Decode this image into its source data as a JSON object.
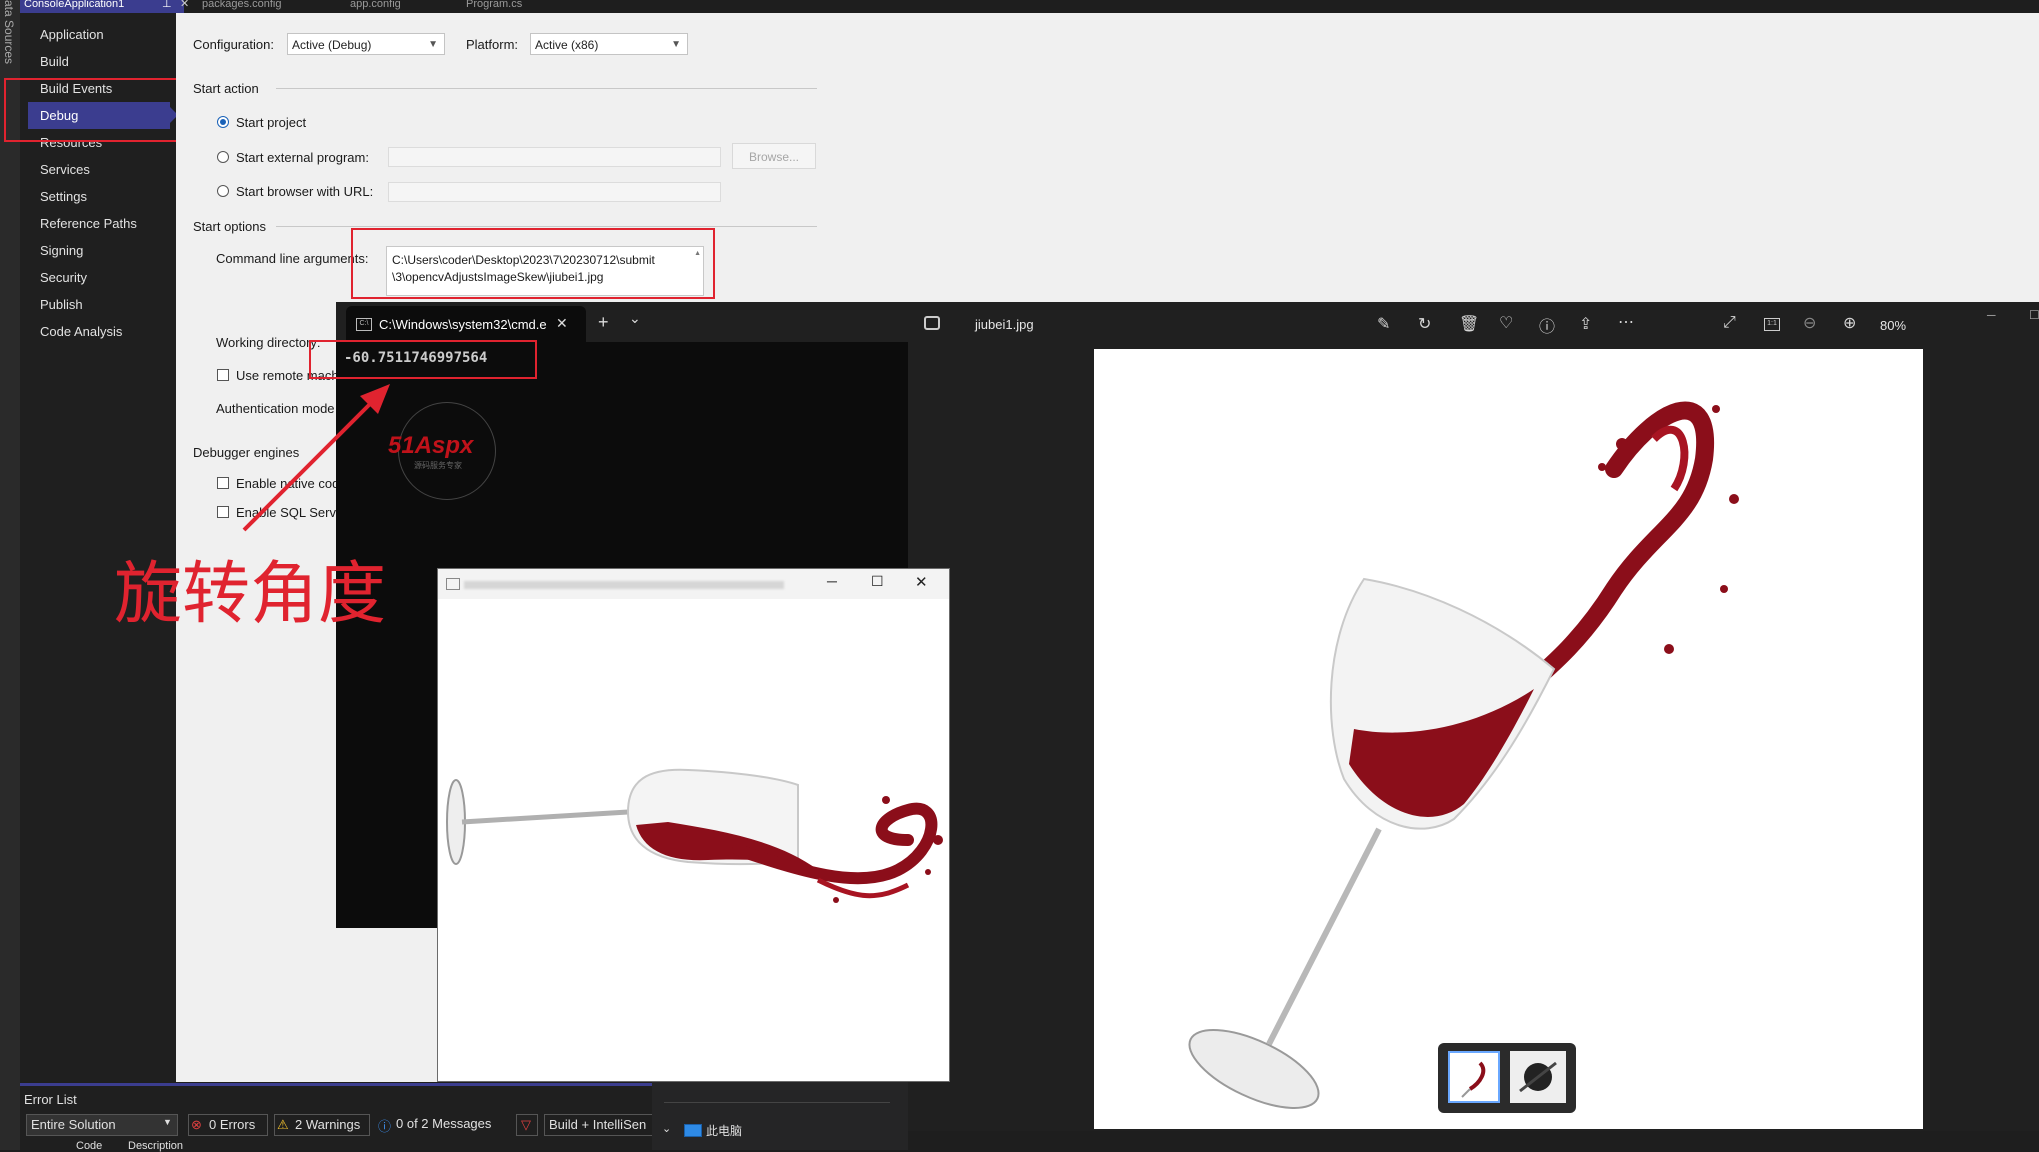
{
  "vs_tabs": [
    "ConsoleApplication1",
    "packages.config",
    "app.config",
    "Program.cs"
  ],
  "left_strip_text": "ata Sources",
  "nav": {
    "items": [
      "Application",
      "Build",
      "Build Events",
      "Debug",
      "Resources",
      "Services",
      "Settings",
      "Reference Paths",
      "Signing",
      "Security",
      "Publish",
      "Code Analysis"
    ],
    "selected": "Debug"
  },
  "config": {
    "configuration_label": "Configuration:",
    "configuration_value": "Active (Debug)",
    "platform_label": "Platform:",
    "platform_value": "Active (x86)"
  },
  "start_action": {
    "header": "Start action",
    "start_project": "Start project",
    "start_external": "Start external program:",
    "browse": "Browse...",
    "start_browser": "Start browser with URL:"
  },
  "start_options": {
    "header": "Start options",
    "cmd_args_label": "Command line arguments:",
    "cmd_args_line1": "C:\\Users\\coder\\Desktop\\2023\\7\\20230712\\submit",
    "cmd_args_line2": "\\3\\opencvAdjustsImageSkew\\jiubei1.jpg",
    "working_dir": "Working directory:",
    "use_remote": "Use remote mach",
    "auth_mode": "Authentication mode"
  },
  "debugger": {
    "header": "Debugger engines",
    "enable_native": "Enable native cod",
    "enable_sql": "Enable SQL Serve"
  },
  "cmd": {
    "tab_title": "C:\\Windows\\system32\\cmd.e",
    "output": "-60.7511746997564",
    "plus": "+",
    "chevron": "⌄",
    "close": "✕"
  },
  "watermark": {
    "brand": "51Aspx",
    "sub": "源码服务专家"
  },
  "annotation": "旋转角度",
  "small_window": {
    "title": "",
    "min": "─",
    "max": "☐",
    "close": "✕"
  },
  "photos": {
    "filename": "jiubei1.jpg",
    "zoom": "80%",
    "icons": [
      "edit-icon",
      "rotate-icon",
      "delete-icon",
      "favorite-icon",
      "info-icon",
      "share-icon",
      "more-icon",
      "fullscreen-icon",
      "actual-size-icon",
      "zoom-out-icon",
      "zoom-in-icon"
    ]
  },
  "error_list": {
    "title": "Error List",
    "scope": "Entire Solution",
    "errors": "0 Errors",
    "warnings": "2 Warnings",
    "messages": "0 of 2 Messages",
    "build": "Build + IntelliSen",
    "col_code": "Code",
    "col_desc": "Description"
  },
  "explorer": {
    "this_pc": "此电脑"
  },
  "colors": {
    "accent": "#3b3d8f",
    "red_box": "#e0232f",
    "annotation": "#e0232f",
    "wine": "#8b0e1a"
  }
}
